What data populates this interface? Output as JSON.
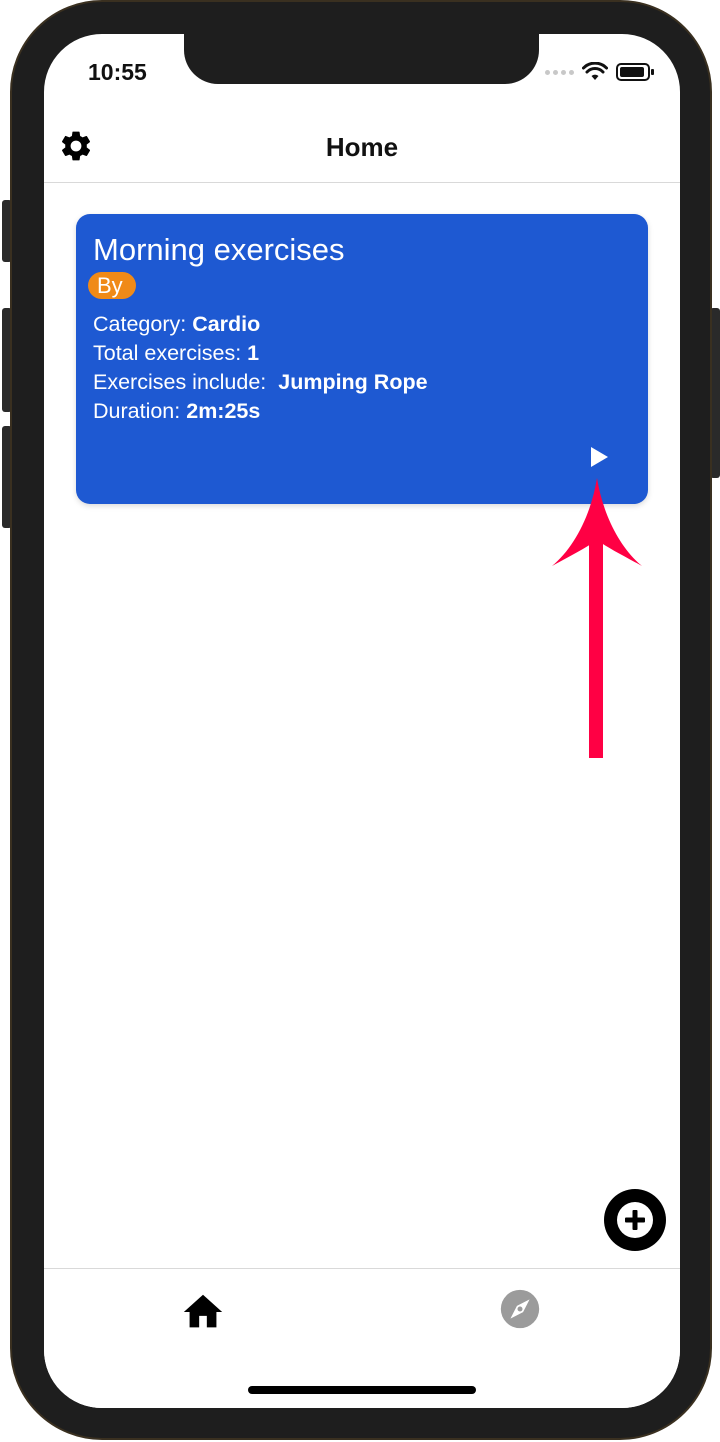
{
  "status_bar": {
    "time": "10:55"
  },
  "nav": {
    "title": "Home",
    "settings_icon": "gear-icon"
  },
  "card": {
    "title": "Morning exercises",
    "badge": "By",
    "category_label": "Category:",
    "category_value": "Cardio",
    "total_label": "Total exercises:",
    "total_value": "1",
    "includes_label": "Exercises include:",
    "includes_value": "Jumping Rope",
    "duration_label": "Duration:",
    "duration_value": "2m:25s",
    "play_icon": "play-icon",
    "background_color": "#1e59d2",
    "badge_color": "#f08a17"
  },
  "annotation": {
    "arrow_color": "#ff0044"
  },
  "fab": {
    "icon": "plus-icon"
  },
  "tabbar": {
    "tabs": [
      {
        "icon": "home-icon",
        "active": true
      },
      {
        "icon": "compass-icon",
        "active": false
      }
    ]
  }
}
